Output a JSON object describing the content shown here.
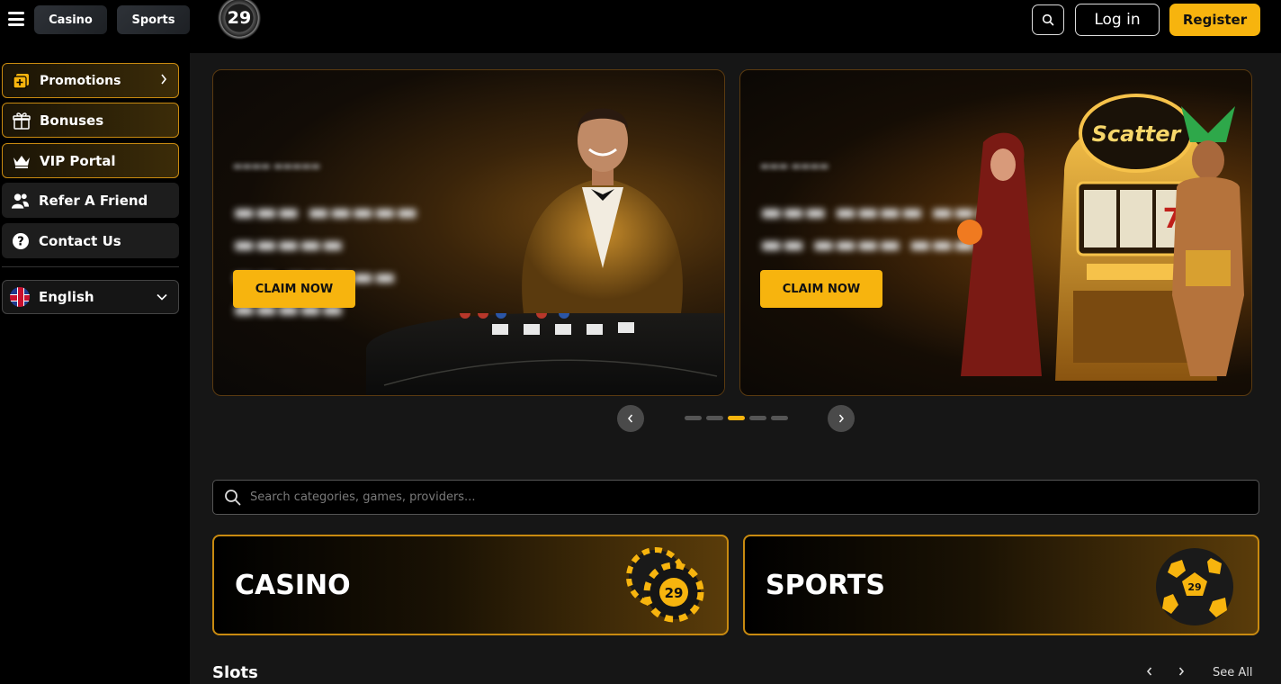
{
  "header": {
    "tabs": [
      "Casino",
      "Sports"
    ],
    "logo_text": "29",
    "login_label": "Log in",
    "register_label": "Register"
  },
  "sidebar": {
    "items": [
      {
        "label": "Promotions",
        "icon": "promotions-icon"
      },
      {
        "label": "Bonuses",
        "icon": "gift-icon"
      },
      {
        "label": "VIP Portal",
        "icon": "crown-icon"
      },
      {
        "label": "Refer A Friend",
        "icon": "users-icon"
      },
      {
        "label": "Contact Us",
        "icon": "help-icon"
      }
    ],
    "language": "English"
  },
  "banners": [
    {
      "cta": "CLAIM NOW"
    },
    {
      "cta": "CLAIM NOW"
    }
  ],
  "carousel": {
    "dot_count": 5,
    "active_index": 2
  },
  "search": {
    "placeholder": "Search categories, games, providers..."
  },
  "categories": [
    "CASINO",
    "SPORTS"
  ],
  "slots": {
    "title": "Slots",
    "see_all": "See All"
  },
  "colors": {
    "accent": "#f7b40e",
    "gold_border": "#c88a10",
    "background": "#161616"
  }
}
